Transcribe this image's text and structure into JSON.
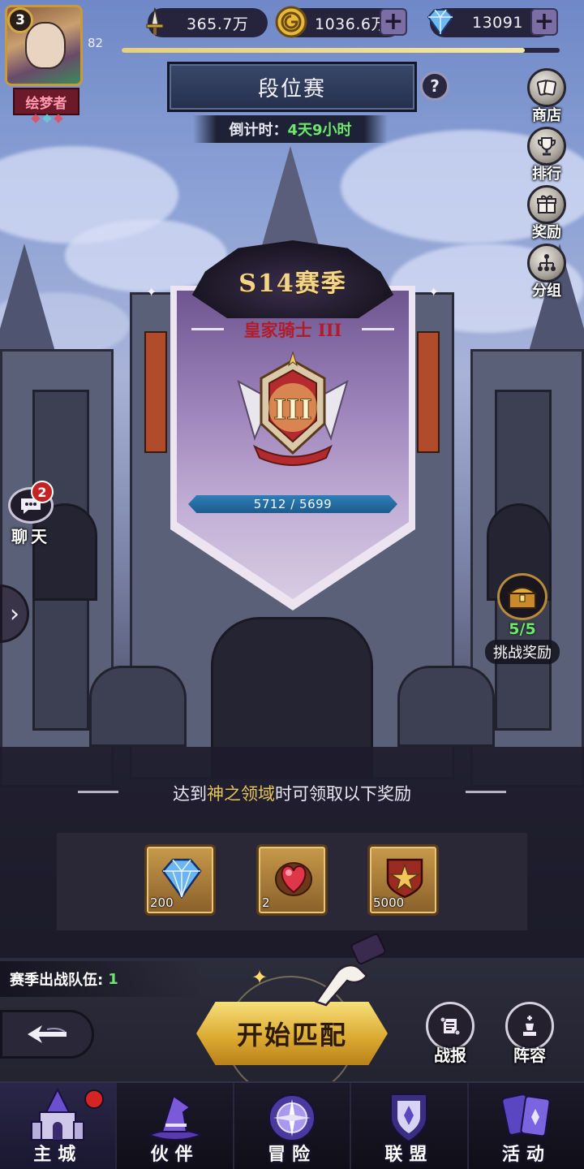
{
  "player": {
    "level": "3",
    "exp_level": "82",
    "exp_progress": 0.92,
    "name_tag": "绘梦者"
  },
  "resources": {
    "power": "365.7万",
    "gold": "1036.6万",
    "gems": "13091"
  },
  "header": {
    "title": "段位赛",
    "help": "?",
    "countdown_label": "倒计时：",
    "countdown_value": "4天9小时"
  },
  "side_menu": [
    {
      "label": "商店",
      "icon": "card-stack-icon"
    },
    {
      "label": "排行",
      "icon": "trophy-icon"
    },
    {
      "label": "奖励",
      "icon": "gift-box-icon"
    },
    {
      "label": "分组",
      "icon": "group-tree-icon"
    }
  ],
  "season": {
    "label": "S14赛季",
    "rank": "皇家骑士 III",
    "rank_numeral": "III",
    "points_text": "5712 / 5699"
  },
  "chat": {
    "label": "聊天",
    "badge": "2"
  },
  "challenge_reward": {
    "count": "5/5",
    "label": "挑战奖励"
  },
  "rewards": {
    "title_prefix": "达到",
    "title_highlight": "神之领域",
    "title_suffix": "时可领取以下奖励",
    "items": [
      {
        "name": "diamond-icon",
        "count": "200"
      },
      {
        "name": "heart-gem-icon",
        "count": "2"
      },
      {
        "name": "star-badge-icon",
        "count": "5000"
      }
    ]
  },
  "team": {
    "label": "赛季出战队伍:",
    "value": "1"
  },
  "actions": {
    "start_match": "开始匹配",
    "battle_report": "战报",
    "lineup": "阵容"
  },
  "nav": [
    {
      "label": "主城",
      "active": true,
      "badge": true
    },
    {
      "label": "伙伴",
      "active": false
    },
    {
      "label": "冒险",
      "active": false
    },
    {
      "label": "联盟",
      "active": false
    },
    {
      "label": "活动",
      "active": false
    }
  ],
  "colors": {
    "accent_gold": "#e6c65a",
    "highlight_green": "#6ee86a",
    "rank_red": "#b01c2a",
    "progress_blue": "#2d7fb8"
  }
}
